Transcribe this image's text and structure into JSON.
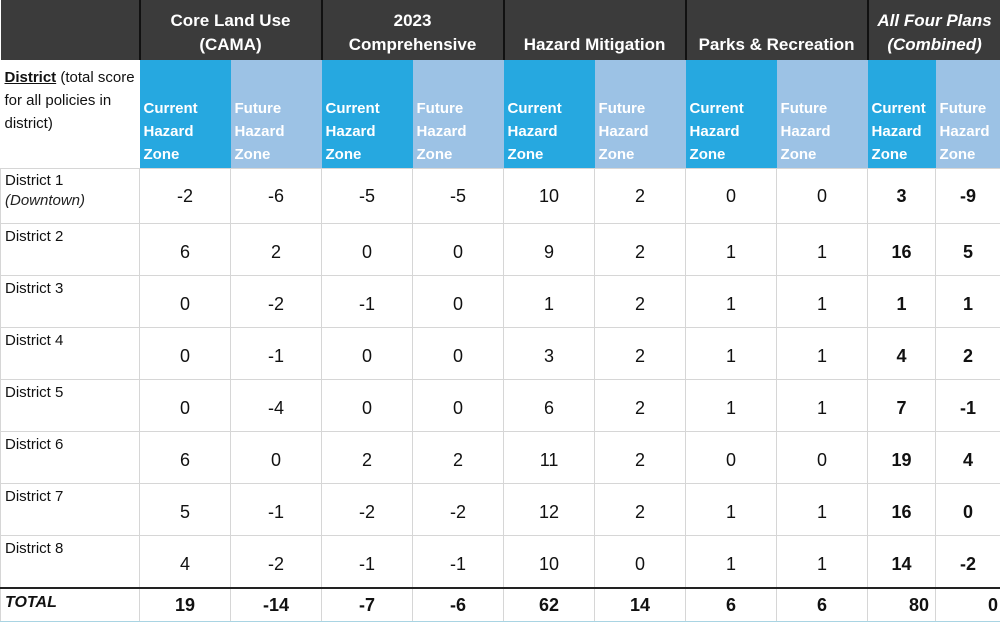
{
  "table": {
    "district_header": {
      "bold_label": "District",
      "rest_label": " (total score for all policies in district)"
    },
    "plans": [
      {
        "line1": "Core Land Use",
        "line2": "(CAMA)",
        "italic": false
      },
      {
        "line1": "2023",
        "line2": "Comprehensive",
        "italic": false
      },
      {
        "line1": "",
        "line2": "Hazard Mitigation",
        "italic": false
      },
      {
        "line1": "",
        "line2": "Parks & Recreation",
        "italic": false
      },
      {
        "line1": "All Four Plans",
        "line2": "(Combined)",
        "italic": true
      }
    ],
    "zone_labels": {
      "current": [
        "Current",
        "Hazard",
        "Zone"
      ],
      "future": [
        "Future",
        "Hazard",
        "Zone"
      ]
    },
    "columns": [
      "Core Land Use (CAMA) - Current Hazard Zone",
      "Core Land Use (CAMA) - Future Hazard Zone",
      "2023 Comprehensive - Current Hazard Zone",
      "2023 Comprehensive - Future Hazard Zone",
      "Hazard Mitigation - Current Hazard Zone",
      "Hazard Mitigation - Future Hazard Zone",
      "Parks & Recreation - Current Hazard Zone",
      "Parks & Recreation - Future Hazard Zone",
      "All Four Plans (Combined) - Current Hazard Zone",
      "All Four Plans (Combined) - Future Hazard Zone"
    ],
    "rows": [
      {
        "name": "District 1",
        "sub": "(Downtown)",
        "values": [
          "-2",
          "-6",
          "-5",
          "-5",
          "10",
          "2",
          "0",
          "0",
          "3",
          "-9"
        ]
      },
      {
        "name": "District 2",
        "sub": "",
        "values": [
          "6",
          "2",
          "0",
          "0",
          "9",
          "2",
          "1",
          "1",
          "16",
          "5"
        ]
      },
      {
        "name": "District 3",
        "sub": "",
        "values": [
          "0",
          "-2",
          "-1",
          "0",
          "1",
          "2",
          "1",
          "1",
          "1",
          "1"
        ]
      },
      {
        "name": "District 4",
        "sub": "",
        "values": [
          "0",
          "-1",
          "0",
          "0",
          "3",
          "2",
          "1",
          "1",
          "4",
          "2"
        ]
      },
      {
        "name": "District 5",
        "sub": "",
        "values": [
          "0",
          "-4",
          "0",
          "0",
          "6",
          "2",
          "1",
          "1",
          "7",
          "-1"
        ]
      },
      {
        "name": "District 6",
        "sub": "",
        "values": [
          "6",
          "0",
          "2",
          "2",
          "11",
          "2",
          "0",
          "0",
          "19",
          "4"
        ]
      },
      {
        "name": "District 7",
        "sub": "",
        "values": [
          "5",
          "-1",
          "-2",
          "-2",
          "12",
          "2",
          "1",
          "1",
          "16",
          "0"
        ]
      },
      {
        "name": "District 8",
        "sub": "",
        "values": [
          "4",
          "-2",
          "-1",
          "-1",
          "10",
          "0",
          "1",
          "1",
          "14",
          "-2"
        ]
      }
    ],
    "total": {
      "label": "TOTAL",
      "values": [
        "19",
        "-14",
        "-7",
        "-6",
        "62",
        "14",
        "6",
        "6",
        "80",
        "0"
      ]
    },
    "colors": {
      "plan_header_bg": "#3b3b3b",
      "current_zone_bg": "#26a8e0",
      "future_zone_bg": "#9cc2e5"
    }
  }
}
